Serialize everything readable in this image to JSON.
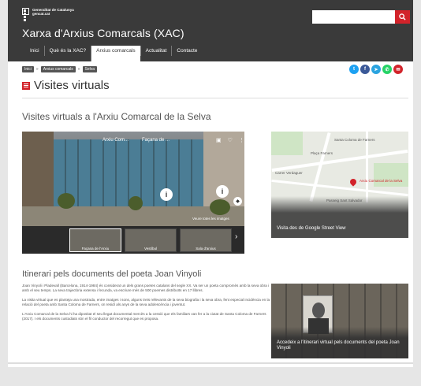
{
  "header": {
    "logo_line1": "Generalitat de Catalunya",
    "logo_line2": "gencat.cat",
    "site_title": "Xarxa d'Arxius Comarcals (XAC)",
    "search_placeholder": "",
    "search_icon": "search-icon"
  },
  "nav": {
    "tabs": [
      {
        "label": "Inici",
        "active": false
      },
      {
        "label": "Què és la XAC?",
        "active": false
      },
      {
        "label": "Arxius comarcals",
        "active": true
      },
      {
        "label": "Actualitat",
        "active": false
      },
      {
        "label": "Contacte",
        "active": false
      }
    ]
  },
  "breadcrumb": [
    "Inici",
    "Arxius comarcals",
    "Selva"
  ],
  "social": [
    {
      "icon": "twitter-icon",
      "color": "#1da1f2"
    },
    {
      "icon": "facebook-icon",
      "color": "#3b5998"
    },
    {
      "icon": "telegram-icon",
      "color": "#2aa3df"
    },
    {
      "icon": "whatsapp-icon",
      "color": "#25d366"
    },
    {
      "icon": "email-icon",
      "color": "#d2232a"
    }
  ],
  "page_title": "Visites virtuals",
  "section_title": "Visites virtuals a l'Arxiu Comarcal de la Selva",
  "tour": {
    "title1": "Arxiu Com...",
    "title2": "Façana de ...",
    "view_all": "Veure totes les imatges",
    "thumbs": [
      "Façana de l'Arxiu",
      "Vestíbul",
      "Sala d'arxius"
    ]
  },
  "map": {
    "labels": [
      "Santa Coloma de Farners",
      "Arxiu Comarcal de la Selva",
      "Plaça Farners",
      "Carrer Verdaguer",
      "Passeig Sant Salvador"
    ],
    "caption": "Visita des de Google Street View"
  },
  "poet": {
    "title": "Itinerari pels documents del poeta Joan Vinyoli",
    "paragraphs": [
      "Joan Vinyoli i Pladevall (Barcelona, 1914-1984) és considerat un dels grans poetes catalans del segle XX. Va ser un poeta compromès amb la seva obra i amb el seu temps. La seva trajectòria extensa i fecunda, va escriure més de 500 poemes distribuïts en 17 llibres.",
      "La visita virtual que es planteja una mostrada, entre imatges i sons, alguns trets rellevants de la seva biografia i la seva obra, fent especial incidència en la relació del poeta amb Santa Coloma de Farners, on residí als anys de la seva adolescència i joventut.",
      "L'Arxiu Comarcal de la Selva hi ha dipositat el seu llegat documental mercès a la cessió que els familiars van fer a la ciutat de Santa Coloma de Farners (2017). I els documents custodiats són el fil conductor del recorregut que es proposa."
    ],
    "card_caption": "Accedeix a l'itinerari virtual pels documents del poeta Joan Vinyoli"
  }
}
